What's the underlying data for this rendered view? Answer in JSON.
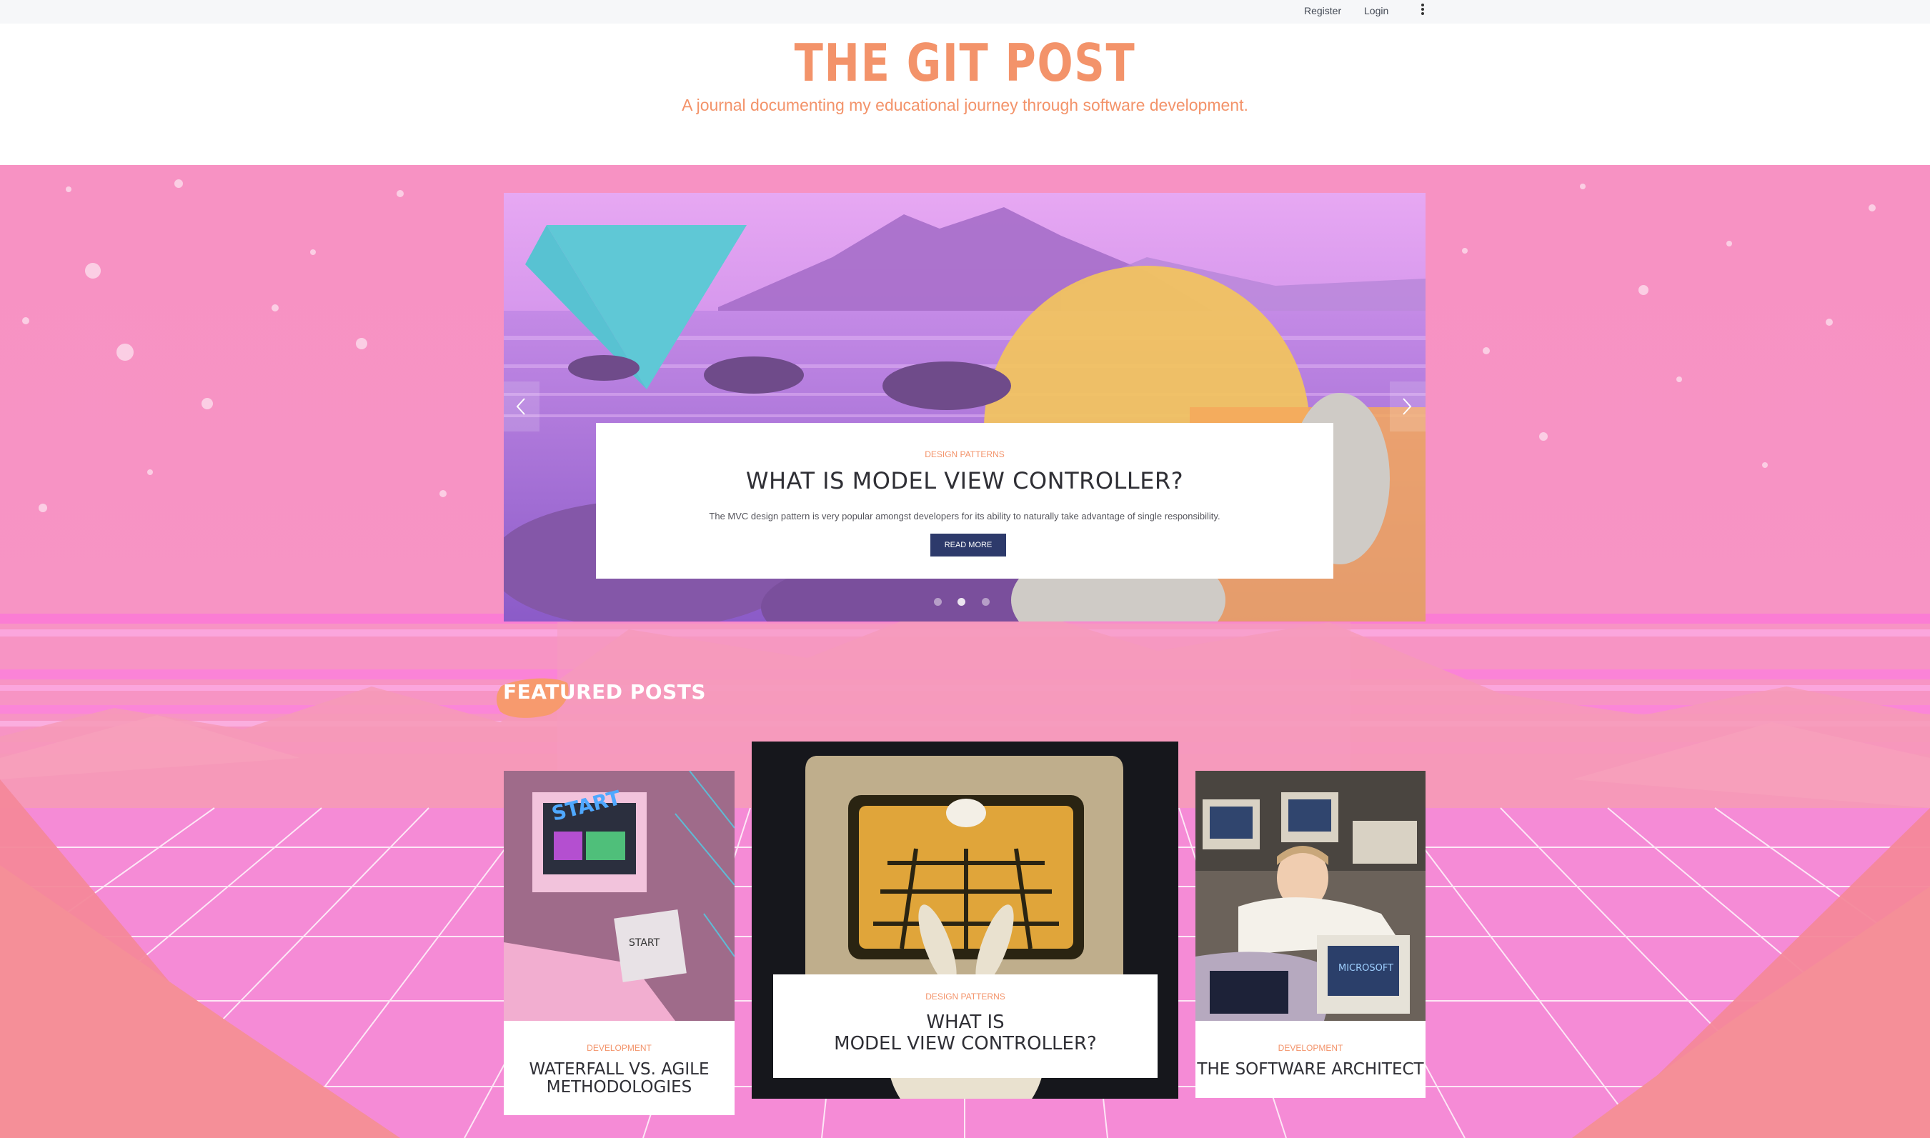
{
  "topbar": {
    "register_label": "Register",
    "login_label": "Login"
  },
  "header": {
    "title": "THE GIT POST",
    "tagline": "A journal documenting my educational journey through software development."
  },
  "carousel": {
    "category": "DESIGN PATTERNS",
    "title": "WHAT IS MODEL VIEW CONTROLLER?",
    "description": "The MVC design pattern is very popular amongst developers for its ability to naturally take advantage of single responsibility.",
    "button_label": "READ MORE",
    "slide_count": 3,
    "active_slide": 2
  },
  "featured": {
    "heading": "FEATURED POSTS",
    "posts": [
      {
        "category": "DEVELOPMENT",
        "title_line1": "WATERFALL VS. AGILE",
        "title_line2": "METHODOLOGIES"
      },
      {
        "category": "DESIGN PATTERNS",
        "title_line1": "WHAT IS",
        "title_line2": "MODEL VIEW CONTROLLER?"
      },
      {
        "category": "DEVELOPMENT",
        "title_line1": "THE SOFTWARE ARCHITECT"
      }
    ]
  },
  "colors": {
    "accent": "#f3936a",
    "hero_pink": "#f792c3",
    "button_navy": "#2d3a6b",
    "text_dark": "#2f2f35"
  }
}
